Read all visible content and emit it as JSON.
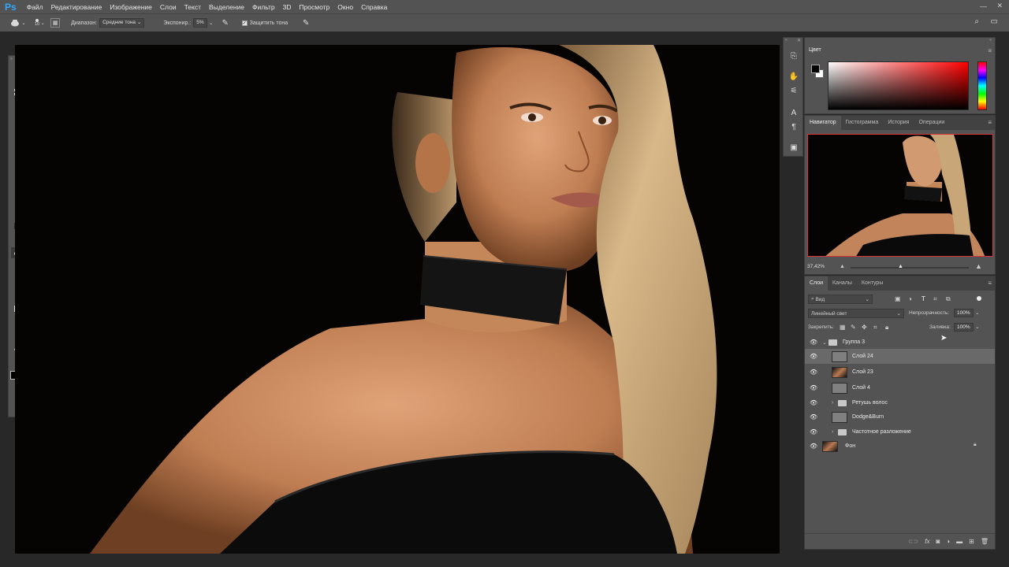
{
  "app": {
    "logo": "Ps"
  },
  "menu": [
    "Файл",
    "Редактирование",
    "Изображение",
    "Слои",
    "Текст",
    "Выделение",
    "Фильтр",
    "3D",
    "Просмотр",
    "Окно",
    "Справка"
  ],
  "options": {
    "brush_size": "10",
    "range_label": "Диапазон:",
    "range_value": "Средние тона",
    "exposure_label": "Экспонир.:",
    "exposure_value": "5%",
    "protect_label": "Защитить тона"
  },
  "color_panel": {
    "title": "Цвет",
    "foreground": "#000000",
    "background": "#ffffff"
  },
  "navigator": {
    "tabs": [
      "Навигатор",
      "Гистограмма",
      "История",
      "Операции"
    ],
    "zoom": "37,42%"
  },
  "layers_panel": {
    "tabs": [
      "Слои",
      "Каналы",
      "Контуры"
    ],
    "filter_label": "Вид",
    "blend_mode": "Линейный свет",
    "opacity_label": "Непрозрачность:",
    "opacity_value": "100%",
    "lock_label": "Закрепить:",
    "fill_label": "Заливка:",
    "fill_value": "100%",
    "layers": [
      {
        "name": "Группа 3",
        "type": "group",
        "expanded": true,
        "indent": 0
      },
      {
        "name": "Слой 24",
        "type": "gray",
        "selected": true,
        "indent": 1
      },
      {
        "name": "Слой 23",
        "type": "photo",
        "indent": 1
      },
      {
        "name": "Слой 4",
        "type": "gray",
        "indent": 1
      },
      {
        "name": "Ретушь волос",
        "type": "group",
        "expanded": false,
        "indent": 1
      },
      {
        "name": "Dodge&Burn",
        "type": "gray",
        "indent": 1
      },
      {
        "name": "Частотное разложение",
        "type": "group",
        "expanded": false,
        "indent": 1
      },
      {
        "name": "Фон",
        "type": "photo",
        "locked": true,
        "indent": 0
      }
    ]
  },
  "colors": {
    "accent_red": "#d8343b",
    "ui_panel": "#535353",
    "ui_dark": "#282828"
  }
}
